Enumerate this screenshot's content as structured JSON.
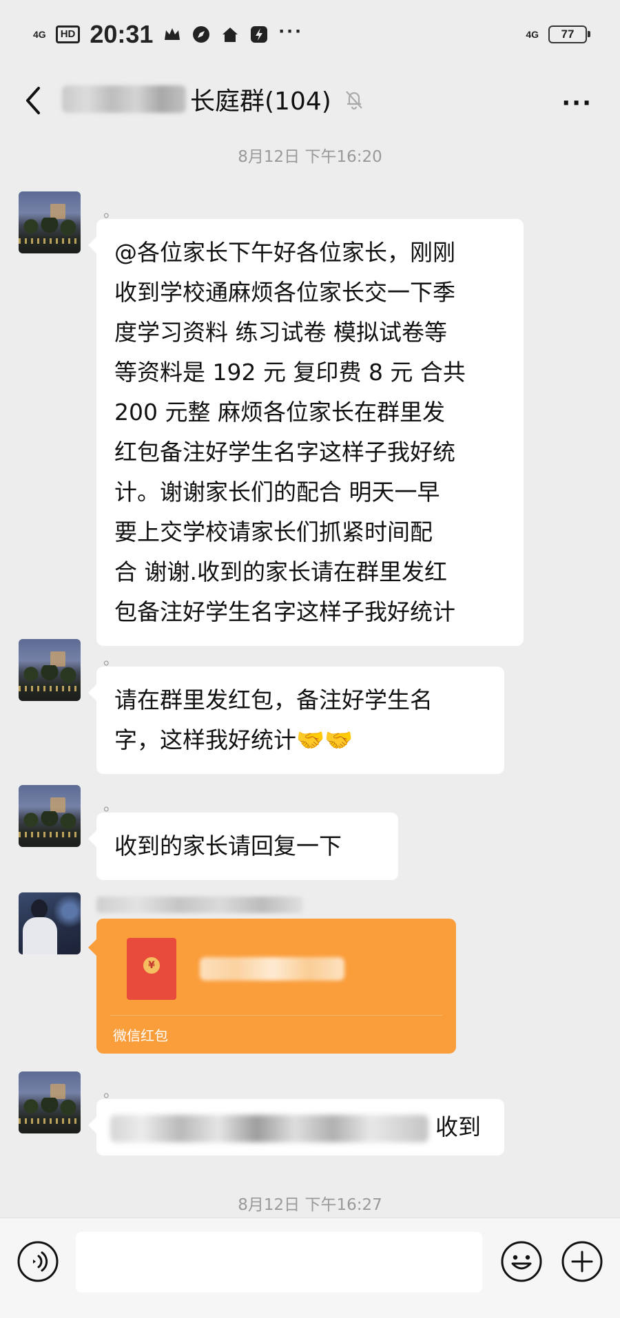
{
  "status_bar": {
    "network_left": "4G",
    "hd": "HD",
    "time": "20:31",
    "more": "···",
    "network_right": "4G",
    "battery": "77"
  },
  "header": {
    "title": "长庭群(104)",
    "more": "···",
    "back_icon": "chevron-left-icon",
    "mute_icon": "bell-off-icon"
  },
  "timestamps": [
    "8月12日 下午16:20",
    "8月12日 下午16:27"
  ],
  "messages": [
    {
      "nickname": "。",
      "lines": [
        "@各位家长下午好各位家长，刚刚",
        "收到学校通麻烦各位家长交一下季",
        "度学习资料 练习试卷 模拟试卷等",
        "等资料是 192 元   复印费 8 元 合共",
        "200 元整  麻烦各位家长在群里发",
        "红包备注好学生名字这样子我好统",
        "计。谢谢家长们的配合 明天一早",
        "要上交学校请家长们抓紧时间配",
        "合 谢谢.收到的家长请在群里发红",
        "包备注好学生名字这样子我好统计"
      ]
    },
    {
      "nickname": "。",
      "lines": [
        "请在群里发红包，备注好学生名",
        "字，这样我好统计🤝🤝"
      ]
    },
    {
      "nickname": "。",
      "lines": [
        "收到的家长请回复一下"
      ]
    },
    {
      "nickname": "",
      "red_packet_label": "微信红包",
      "red_packet_icon": "¥"
    },
    {
      "nickname": "。",
      "text": "收到"
    }
  ],
  "input_bar": {
    "voice_icon": "voice-icon",
    "emoji_icon": "emoji-icon",
    "plus_icon": "plus-icon"
  }
}
